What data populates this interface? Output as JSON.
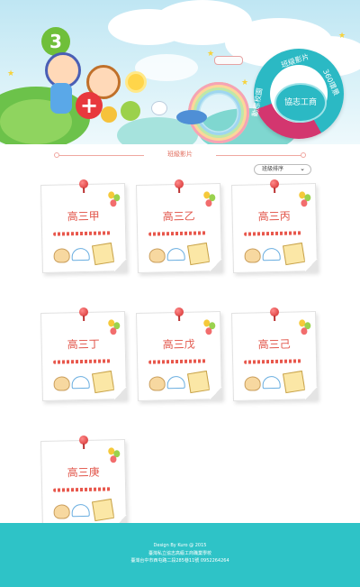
{
  "banner": {
    "balloon_number": "3",
    "ring_menu": {
      "center": "協志工商",
      "top_item": "班級影片",
      "right_item": "360環景",
      "left_item": "動態校園"
    }
  },
  "section": {
    "title": "班級影片",
    "sort": {
      "selected": "班級排序"
    }
  },
  "classes": [
    {
      "label": "高三甲"
    },
    {
      "label": "高三乙"
    },
    {
      "label": "高三丙"
    },
    {
      "label": "高三丁"
    },
    {
      "label": "高三戊"
    },
    {
      "label": "高三己"
    },
    {
      "label": "高三庚"
    }
  ],
  "footer": {
    "line1": "Design By Kuro @ 2015",
    "line2": "臺灣私立協志高級工商職業學校",
    "line3": "臺灣台中市西屯路二段285巷11號 0952264264"
  },
  "colors": {
    "accent_teal": "#2ec3c7",
    "accent_magenta": "#d3366f",
    "label_red": "#e2574c"
  }
}
